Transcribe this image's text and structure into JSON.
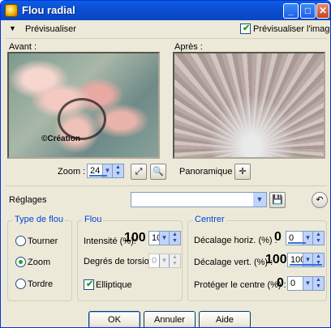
{
  "titlebar": {
    "title": "Flou radial",
    "minimize_label": "_",
    "maximize_label": "□",
    "close_label": "✕"
  },
  "preview_bar": {
    "expand_icon": "▼",
    "label": "Prévisualiser",
    "preview_image_label": "Prévisualiser l'image",
    "preview_image_checked": true
  },
  "panes": {
    "before_label": "Avant :",
    "after_label": "Après :",
    "stamp_text": "©Création Chat...",
    "stamp_text_ref": "©Création"
  },
  "zoom": {
    "label": "Zoom :",
    "value": "24",
    "pan_label": "Panoramique :"
  },
  "settings": {
    "label": "Réglages",
    "preset_value": ""
  },
  "blur_type": {
    "title": "Type de flou",
    "options": [
      {
        "label": "Tourner",
        "selected": false
      },
      {
        "label": "Zoom",
        "selected": true
      },
      {
        "label": "Tordre",
        "selected": false
      }
    ]
  },
  "blur": {
    "title": "Flou",
    "intensity_label": "Intensité (%):",
    "intensity_big": "100",
    "intensity_value": "100",
    "torsion_label": "Degrés de torsion :",
    "torsion_value": "0",
    "elliptic_label": "Elliptique",
    "elliptic_checked": true
  },
  "center": {
    "title": "Centrer",
    "hoffset_label": "Décalage horiz. (%) :",
    "hoffset_big": "0",
    "hoffset_value": "0",
    "voffset_label": "Décalage vert. (%) :",
    "voffset_big": "100",
    "voffset_value": "100",
    "protect_label": "Protéger le centre (%) :",
    "protect_big": "0",
    "protect_value": "0"
  },
  "buttons": {
    "ok": "OK",
    "cancel": "Annuler",
    "help": "Aide"
  }
}
